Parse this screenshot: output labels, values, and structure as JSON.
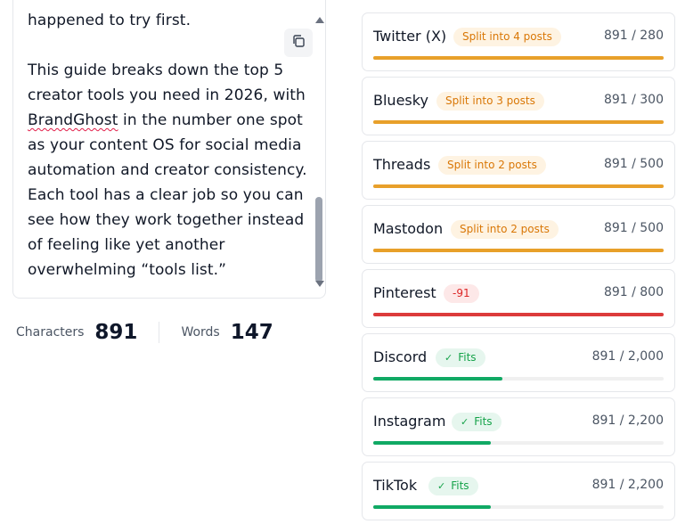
{
  "editor": {
    "lines_top": [
      "happened to try first."
    ],
    "paragraph": {
      "before_link": "This guide breaks down the top 5 creator tools you need in 2026, with ",
      "link_word": "BrandGhost",
      "after_link": " in the number one spot as your content OS for social media automation and creator consistency. Each tool has a clear job so you can see how they work together instead of feeling like yet another overwhelming “tools list.”"
    },
    "copy_icon": "copy-icon",
    "scroll_position": 0.92
  },
  "stats": {
    "characters_label": "Characters",
    "characters_value": "891",
    "words_label": "Words",
    "words_value": "147"
  },
  "platforms": [
    {
      "name": "Twitter (X)",
      "badge": "Split into 4 posts",
      "status": "split",
      "count": "891 / 280",
      "fill": 1.0
    },
    {
      "name": "Bluesky",
      "badge": "Split into 3 posts",
      "status": "split",
      "count": "891 / 300",
      "fill": 1.0
    },
    {
      "name": "Threads",
      "badge": "Split into 2 posts",
      "status": "split",
      "count": "891 / 500",
      "fill": 1.0
    },
    {
      "name": "Mastodon",
      "badge": "Split into 2 posts",
      "status": "split",
      "count": "891 / 500",
      "fill": 1.0
    },
    {
      "name": "Pinterest",
      "badge": "-91",
      "status": "over",
      "count": "891 / 800",
      "fill": 1.0
    },
    {
      "name": "Discord",
      "badge": "Fits",
      "status": "fits",
      "count": "891 / 2,000",
      "fill": 0.4455
    },
    {
      "name": "Instagram",
      "badge": "Fits",
      "status": "fits",
      "count": "891 / 2,200",
      "fill": 0.405
    },
    {
      "name": "TikTok",
      "badge": "Fits",
      "status": "fits",
      "count": "891 / 2,200",
      "fill": 0.405
    }
  ],
  "colors": {
    "split": "#e8a02a",
    "over": "#dc3b3b",
    "fits": "#10a964"
  }
}
